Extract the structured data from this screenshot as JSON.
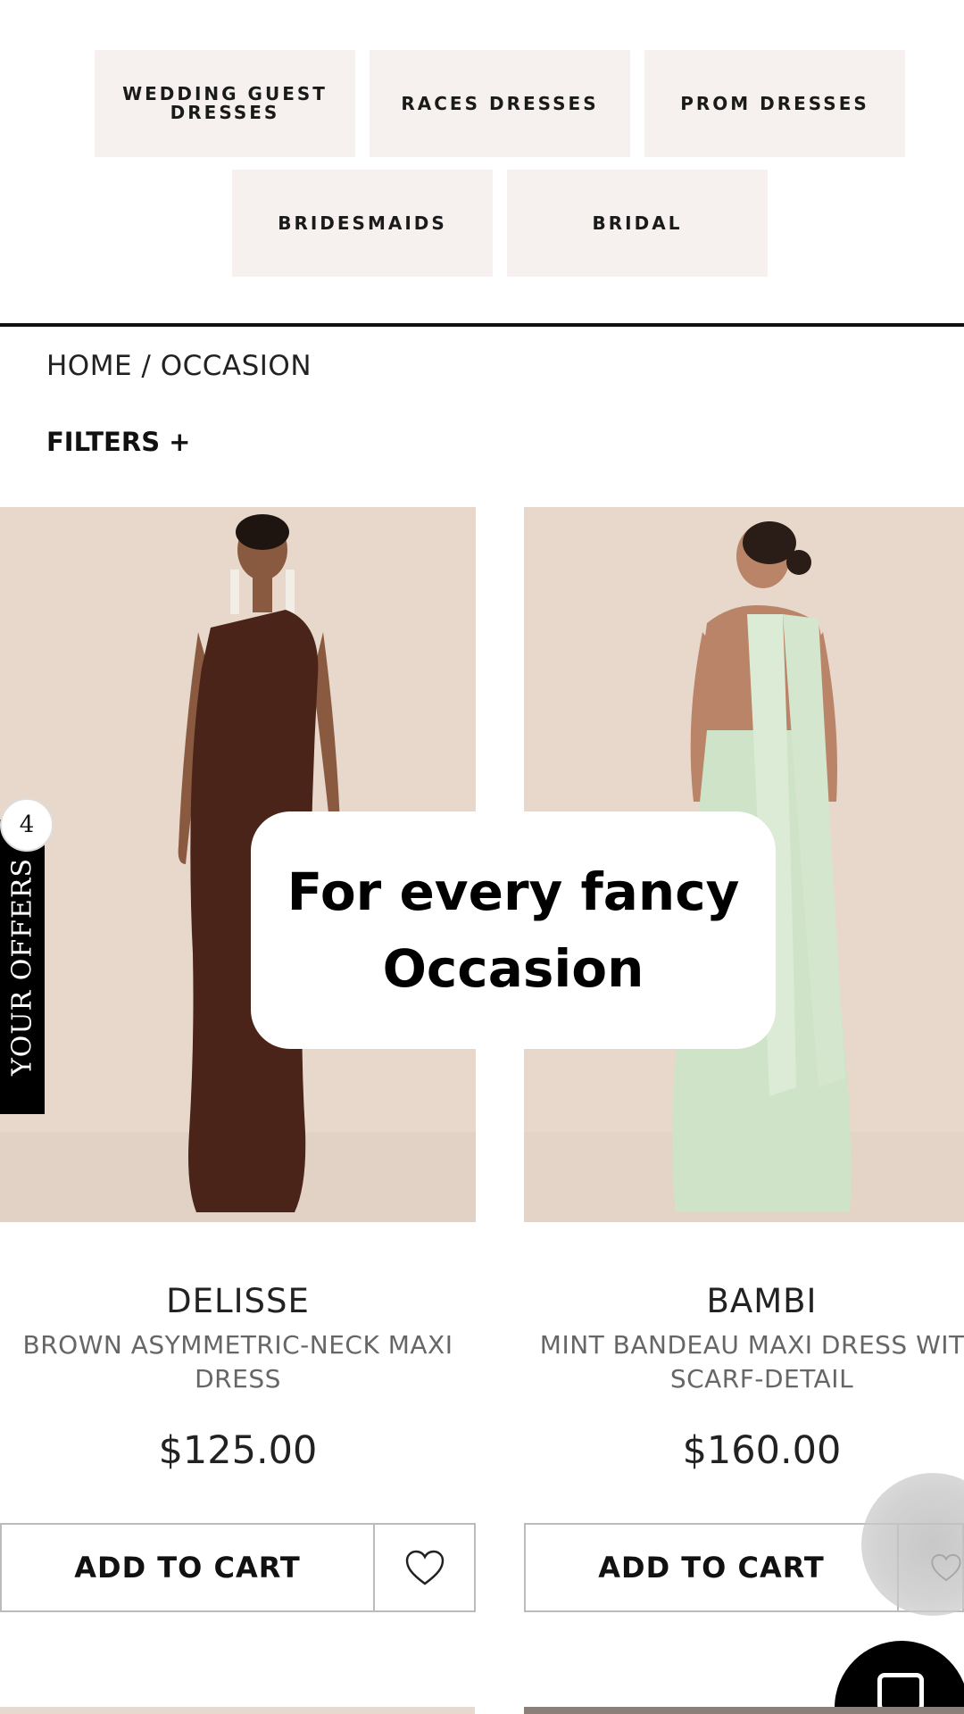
{
  "categories": [
    {
      "label": "WEDDING GUEST\nDRESSES"
    },
    {
      "label": "RACES DRESSES"
    },
    {
      "label": "PROM DRESSES"
    },
    {
      "label": "BRIDESMAIDS"
    },
    {
      "label": "BRIDAL"
    }
  ],
  "breadcrumb": "HOME / OCCASION",
  "filters_label": "FILTERS +",
  "offers": {
    "label": "YOUR OFFERS",
    "count": "4"
  },
  "caption": "For every fancy Occasion",
  "products": [
    {
      "name": "DELISSE",
      "description": "BROWN ASYMMETRIC-NECK MAXI DRESS",
      "price": "$125.00",
      "cart_label": "ADD TO CART",
      "dress_color": "#4a2418"
    },
    {
      "name": "BAMBI",
      "description": "MINT BANDEAU MAXI DRESS WITH SCARF-DETAIL",
      "price": "$160.00",
      "cart_label": "ADD TO CART",
      "dress_color": "#cfe3c9"
    }
  ],
  "colors": {
    "chip_bg": "#f6f1ef",
    "image_bg": "#e8d8cc",
    "text": "#111111"
  }
}
